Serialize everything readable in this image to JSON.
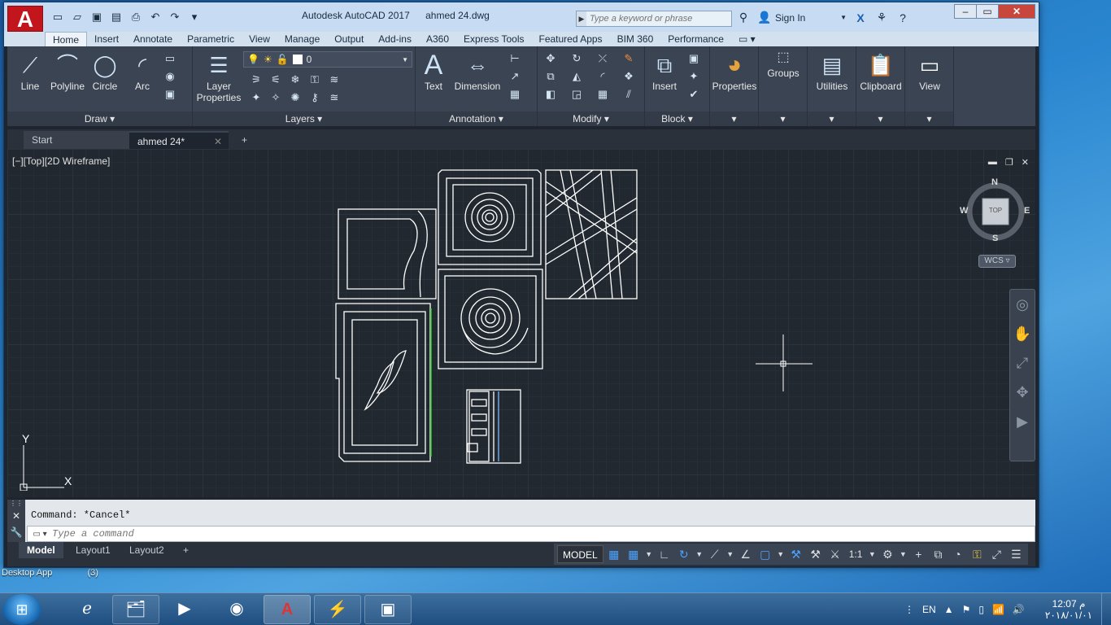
{
  "titlebar": {
    "app_name": "Autodesk AutoCAD 2017",
    "file_name": "ahmed 24.dwg",
    "search_placeholder": "Type a keyword or phrase",
    "sign_in": "Sign In"
  },
  "ribbon_tabs": [
    "Home",
    "Insert",
    "Annotate",
    "Parametric",
    "View",
    "Manage",
    "Output",
    "Add-ins",
    "A360",
    "Express Tools",
    "Featured Apps",
    "BIM 360",
    "Performance"
  ],
  "ribbon": {
    "draw": {
      "title": "Draw",
      "line": "Line",
      "polyline": "Polyline",
      "circle": "Circle",
      "arc": "Arc"
    },
    "layers": {
      "title": "Layers",
      "layer_properties": "Layer Properties",
      "current_layer": "0"
    },
    "annotation": {
      "title": "Annotation",
      "text": "Text",
      "dimension": "Dimension"
    },
    "modify": {
      "title": "Modify"
    },
    "block": {
      "title": "Block",
      "insert": "Insert"
    },
    "properties": "Properties",
    "groups": "Groups",
    "utilities": "Utilities",
    "clipboard": "Clipboard",
    "view": "View"
  },
  "doc_tabs": {
    "start": "Start",
    "file": "ahmed 24*"
  },
  "viewport": {
    "label": "[−][Top][2D Wireframe]",
    "compass": {
      "n": "N",
      "s": "S",
      "e": "E",
      "w": "W",
      "top": "TOP"
    },
    "wcs": "WCS",
    "ucs_x": "X",
    "ucs_y": "Y"
  },
  "command": {
    "history": "Command: *Cancel*",
    "placeholder": "Type a command"
  },
  "layout_tabs": [
    "Model",
    "Layout1",
    "Layout2"
  ],
  "status": {
    "model": "MODEL",
    "scale": "1:1"
  },
  "desktop": {
    "app_label": "Desktop App",
    "count": "(3)"
  },
  "taskbar": {
    "lang": "EN",
    "time": "12:07 م",
    "date": "٢٠١٨/٠١/٠١"
  },
  "colors": {
    "accent_red": "#c3161c",
    "viewport_bg": "#212830",
    "ribbon_bg": "#3b4453"
  }
}
